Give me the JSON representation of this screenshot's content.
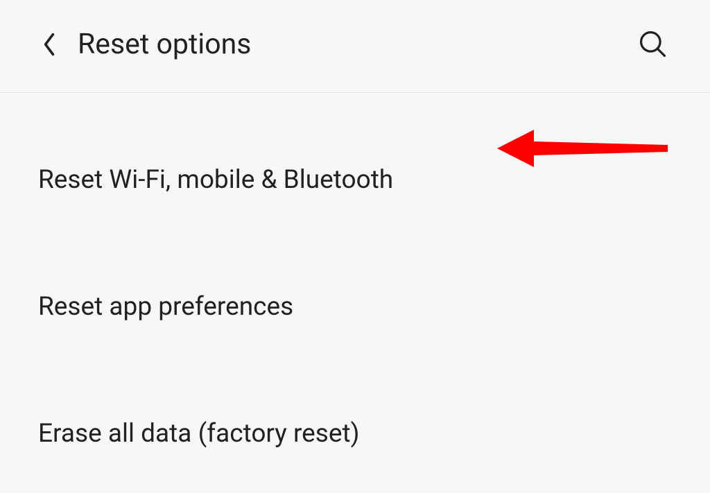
{
  "header": {
    "title": "Reset options"
  },
  "options": [
    {
      "label": "Reset Wi-Fi, mobile & Bluetooth"
    },
    {
      "label": "Reset app preferences"
    },
    {
      "label": "Erase all data (factory reset)"
    }
  ],
  "annotation": {
    "color": "#ff0000"
  }
}
